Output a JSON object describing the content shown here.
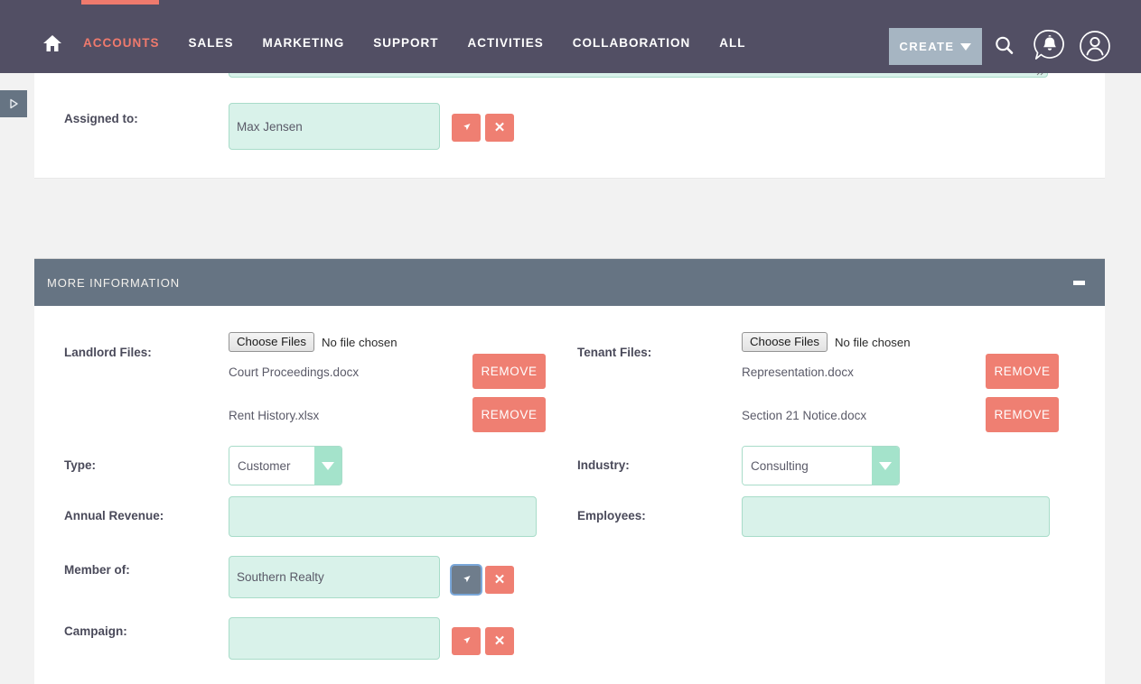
{
  "nav": {
    "home_icon": "home-icon",
    "items": [
      {
        "label": "ACCOUNTS",
        "active": true
      },
      {
        "label": "SALES",
        "active": false
      },
      {
        "label": "MARKETING",
        "active": false
      },
      {
        "label": "SUPPORT",
        "active": false
      },
      {
        "label": "ACTIVITIES",
        "active": false
      },
      {
        "label": "COLLABORATION",
        "active": false
      },
      {
        "label": "ALL",
        "active": false
      }
    ],
    "create_label": "CREATE",
    "search_icon": "search-icon",
    "notifications_icon": "notification-bell-icon",
    "profile_icon": "user-profile-icon",
    "accent_color": "#ef7a6d",
    "bar_color": "#524f64",
    "create_button_color": "#a6b5c2"
  },
  "sidebar_toggle": {
    "icon": "expand-right-triangle-icon"
  },
  "assigned_to": {
    "label": "Assigned to:",
    "value": "Max Jensen",
    "select_icon": "arrow-cursor-icon",
    "clear_icon": "x-close-icon"
  },
  "section": {
    "title": "MORE INFORMATION",
    "collapse_icon": "minus-collapse-icon",
    "header_color": "#667483"
  },
  "files": {
    "landlord": {
      "label": "Landlord Files:",
      "choose_button": "Choose Files",
      "no_file_text": "No file chosen",
      "items": [
        {
          "name": "Court Proceedings.docx",
          "remove_label": "REMOVE"
        },
        {
          "name": "Rent History.xlsx",
          "remove_label": "REMOVE"
        }
      ]
    },
    "tenant": {
      "label": "Tenant Files:",
      "choose_button": "Choose Files",
      "no_file_text": "No file chosen",
      "items": [
        {
          "name": "Representation.docx",
          "remove_label": "REMOVE"
        },
        {
          "name": "Section 21 Notice.docx",
          "remove_label": "REMOVE"
        }
      ]
    }
  },
  "fields": {
    "type": {
      "label": "Type:",
      "value": "Customer"
    },
    "industry": {
      "label": "Industry:",
      "value": "Consulting"
    },
    "annual_revenue": {
      "label": "Annual Revenue:",
      "value": ""
    },
    "employees": {
      "label": "Employees:",
      "value": ""
    },
    "member_of": {
      "label": "Member of:",
      "value": "Southern Realty",
      "select_icon": "arrow-cursor-icon",
      "clear_icon": "x-close-icon",
      "select_pressed": true
    },
    "campaign": {
      "label": "Campaign:",
      "value": "",
      "select_icon": "arrow-cursor-icon",
      "clear_icon": "x-close-icon",
      "select_pressed": false
    }
  },
  "colors": {
    "mint_fill": "#d9f2ea",
    "mint_border": "#a8dcc9",
    "coral": "#ef7f72",
    "slate": "#667483",
    "page_bg": "#f2f2f2"
  }
}
